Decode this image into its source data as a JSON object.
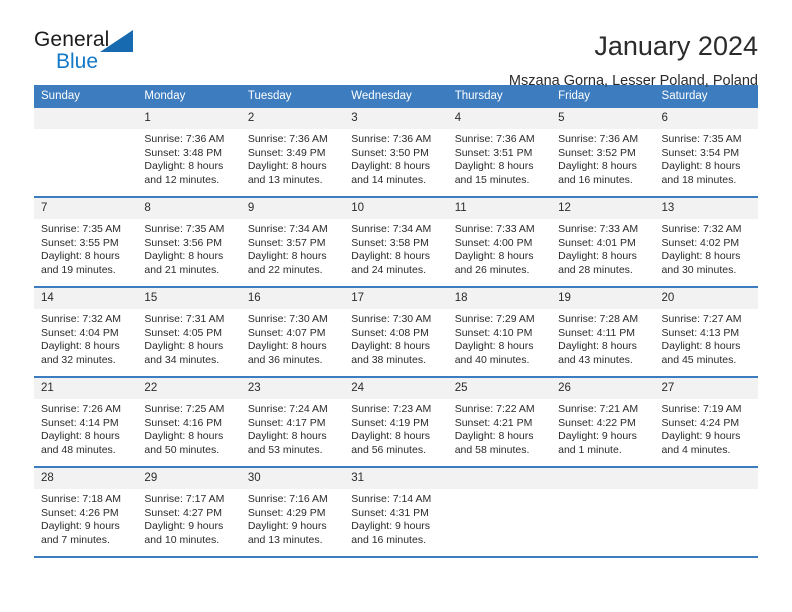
{
  "brand": {
    "name_part1": "General",
    "name_part2": "Blue",
    "accent_color": "#1478c8",
    "triangle_color": "#1769b0"
  },
  "header": {
    "title": "January 2024",
    "location": "Mszana Gorna, Lesser Poland, Poland"
  },
  "calendar": {
    "header_color": "#3c7cbf",
    "day_band_color": "#f2f2f2",
    "weekdays": [
      "Sunday",
      "Monday",
      "Tuesday",
      "Wednesday",
      "Thursday",
      "Friday",
      "Saturday"
    ],
    "weeks": [
      [
        {
          "day": "",
          "sunrise": "",
          "sunset": "",
          "daylight": ""
        },
        {
          "day": "1",
          "sunrise": "Sunrise: 7:36 AM",
          "sunset": "Sunset: 3:48 PM",
          "daylight": "Daylight: 8 hours and 12 minutes."
        },
        {
          "day": "2",
          "sunrise": "Sunrise: 7:36 AM",
          "sunset": "Sunset: 3:49 PM",
          "daylight": "Daylight: 8 hours and 13 minutes."
        },
        {
          "day": "3",
          "sunrise": "Sunrise: 7:36 AM",
          "sunset": "Sunset: 3:50 PM",
          "daylight": "Daylight: 8 hours and 14 minutes."
        },
        {
          "day": "4",
          "sunrise": "Sunrise: 7:36 AM",
          "sunset": "Sunset: 3:51 PM",
          "daylight": "Daylight: 8 hours and 15 minutes."
        },
        {
          "day": "5",
          "sunrise": "Sunrise: 7:36 AM",
          "sunset": "Sunset: 3:52 PM",
          "daylight": "Daylight: 8 hours and 16 minutes."
        },
        {
          "day": "6",
          "sunrise": "Sunrise: 7:35 AM",
          "sunset": "Sunset: 3:54 PM",
          "daylight": "Daylight: 8 hours and 18 minutes."
        }
      ],
      [
        {
          "day": "7",
          "sunrise": "Sunrise: 7:35 AM",
          "sunset": "Sunset: 3:55 PM",
          "daylight": "Daylight: 8 hours and 19 minutes."
        },
        {
          "day": "8",
          "sunrise": "Sunrise: 7:35 AM",
          "sunset": "Sunset: 3:56 PM",
          "daylight": "Daylight: 8 hours and 21 minutes."
        },
        {
          "day": "9",
          "sunrise": "Sunrise: 7:34 AM",
          "sunset": "Sunset: 3:57 PM",
          "daylight": "Daylight: 8 hours and 22 minutes."
        },
        {
          "day": "10",
          "sunrise": "Sunrise: 7:34 AM",
          "sunset": "Sunset: 3:58 PM",
          "daylight": "Daylight: 8 hours and 24 minutes."
        },
        {
          "day": "11",
          "sunrise": "Sunrise: 7:33 AM",
          "sunset": "Sunset: 4:00 PM",
          "daylight": "Daylight: 8 hours and 26 minutes."
        },
        {
          "day": "12",
          "sunrise": "Sunrise: 7:33 AM",
          "sunset": "Sunset: 4:01 PM",
          "daylight": "Daylight: 8 hours and 28 minutes."
        },
        {
          "day": "13",
          "sunrise": "Sunrise: 7:32 AM",
          "sunset": "Sunset: 4:02 PM",
          "daylight": "Daylight: 8 hours and 30 minutes."
        }
      ],
      [
        {
          "day": "14",
          "sunrise": "Sunrise: 7:32 AM",
          "sunset": "Sunset: 4:04 PM",
          "daylight": "Daylight: 8 hours and 32 minutes."
        },
        {
          "day": "15",
          "sunrise": "Sunrise: 7:31 AM",
          "sunset": "Sunset: 4:05 PM",
          "daylight": "Daylight: 8 hours and 34 minutes."
        },
        {
          "day": "16",
          "sunrise": "Sunrise: 7:30 AM",
          "sunset": "Sunset: 4:07 PM",
          "daylight": "Daylight: 8 hours and 36 minutes."
        },
        {
          "day": "17",
          "sunrise": "Sunrise: 7:30 AM",
          "sunset": "Sunset: 4:08 PM",
          "daylight": "Daylight: 8 hours and 38 minutes."
        },
        {
          "day": "18",
          "sunrise": "Sunrise: 7:29 AM",
          "sunset": "Sunset: 4:10 PM",
          "daylight": "Daylight: 8 hours and 40 minutes."
        },
        {
          "day": "19",
          "sunrise": "Sunrise: 7:28 AM",
          "sunset": "Sunset: 4:11 PM",
          "daylight": "Daylight: 8 hours and 43 minutes."
        },
        {
          "day": "20",
          "sunrise": "Sunrise: 7:27 AM",
          "sunset": "Sunset: 4:13 PM",
          "daylight": "Daylight: 8 hours and 45 minutes."
        }
      ],
      [
        {
          "day": "21",
          "sunrise": "Sunrise: 7:26 AM",
          "sunset": "Sunset: 4:14 PM",
          "daylight": "Daylight: 8 hours and 48 minutes."
        },
        {
          "day": "22",
          "sunrise": "Sunrise: 7:25 AM",
          "sunset": "Sunset: 4:16 PM",
          "daylight": "Daylight: 8 hours and 50 minutes."
        },
        {
          "day": "23",
          "sunrise": "Sunrise: 7:24 AM",
          "sunset": "Sunset: 4:17 PM",
          "daylight": "Daylight: 8 hours and 53 minutes."
        },
        {
          "day": "24",
          "sunrise": "Sunrise: 7:23 AM",
          "sunset": "Sunset: 4:19 PM",
          "daylight": "Daylight: 8 hours and 56 minutes."
        },
        {
          "day": "25",
          "sunrise": "Sunrise: 7:22 AM",
          "sunset": "Sunset: 4:21 PM",
          "daylight": "Daylight: 8 hours and 58 minutes."
        },
        {
          "day": "26",
          "sunrise": "Sunrise: 7:21 AM",
          "sunset": "Sunset: 4:22 PM",
          "daylight": "Daylight: 9 hours and 1 minute."
        },
        {
          "day": "27",
          "sunrise": "Sunrise: 7:19 AM",
          "sunset": "Sunset: 4:24 PM",
          "daylight": "Daylight: 9 hours and 4 minutes."
        }
      ],
      [
        {
          "day": "28",
          "sunrise": "Sunrise: 7:18 AM",
          "sunset": "Sunset: 4:26 PM",
          "daylight": "Daylight: 9 hours and 7 minutes."
        },
        {
          "day": "29",
          "sunrise": "Sunrise: 7:17 AM",
          "sunset": "Sunset: 4:27 PM",
          "daylight": "Daylight: 9 hours and 10 minutes."
        },
        {
          "day": "30",
          "sunrise": "Sunrise: 7:16 AM",
          "sunset": "Sunset: 4:29 PM",
          "daylight": "Daylight: 9 hours and 13 minutes."
        },
        {
          "day": "31",
          "sunrise": "Sunrise: 7:14 AM",
          "sunset": "Sunset: 4:31 PM",
          "daylight": "Daylight: 9 hours and 16 minutes."
        },
        {
          "day": "",
          "sunrise": "",
          "sunset": "",
          "daylight": ""
        },
        {
          "day": "",
          "sunrise": "",
          "sunset": "",
          "daylight": ""
        },
        {
          "day": "",
          "sunrise": "",
          "sunset": "",
          "daylight": ""
        }
      ]
    ]
  }
}
